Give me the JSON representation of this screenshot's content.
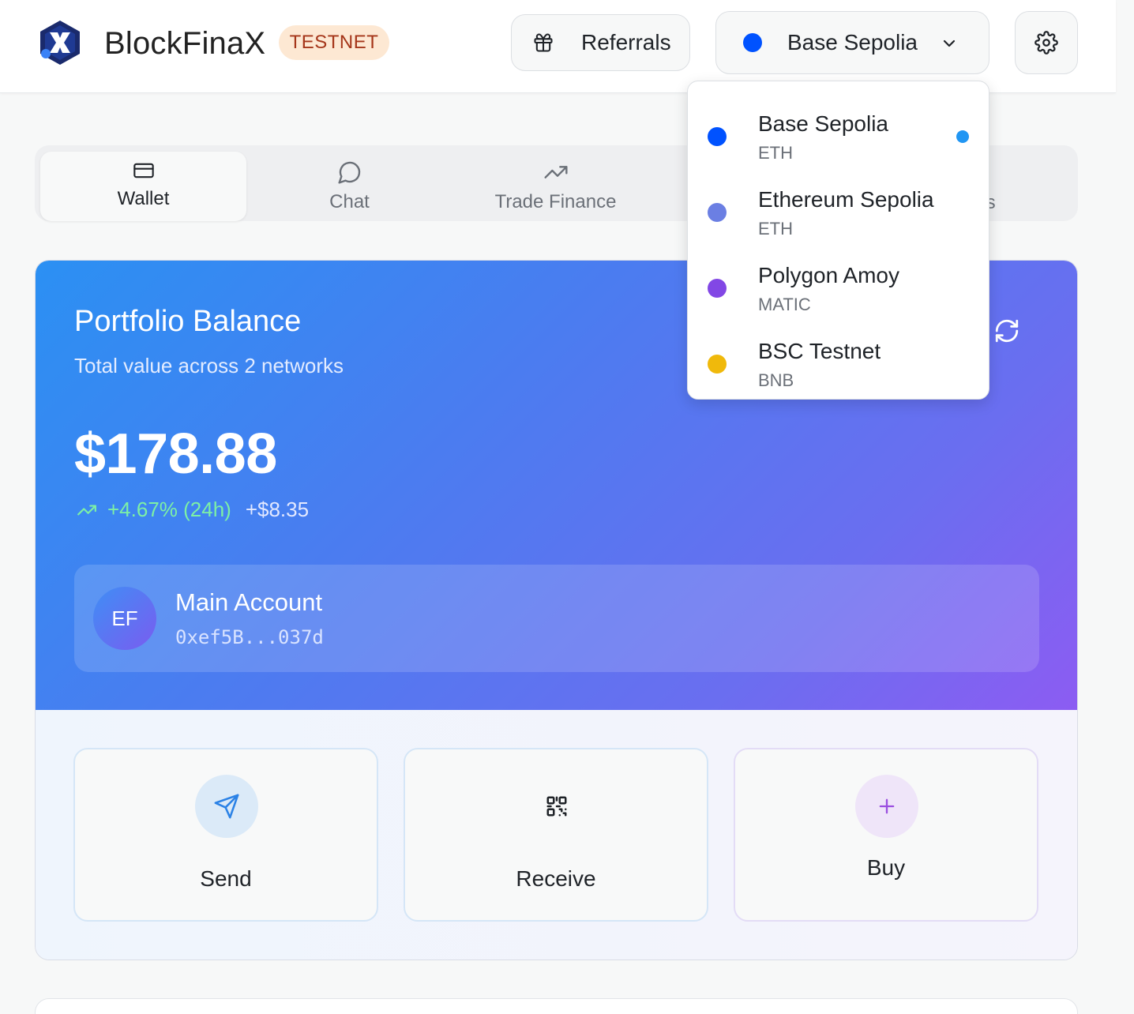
{
  "header": {
    "brand": "BlockFinaX",
    "badge": "TESTNET",
    "referrals_label": "Referrals",
    "network_label": "Base Sepolia",
    "network_color": "#0052ff"
  },
  "tabs": [
    {
      "label": "Wallet",
      "icon": "wallet-icon",
      "active": true
    },
    {
      "label": "Chat",
      "icon": "chat-icon",
      "active": false
    },
    {
      "label": "Trade Finance",
      "icon": "trending-up-icon",
      "active": false
    }
  ],
  "tab_partial": "cts",
  "portfolio": {
    "title": "Portfolio Balance",
    "subtitle": "Total value across 2 networks",
    "balance": "$178.88",
    "change_pct": "+4.67% (24h)",
    "change_amt": "+$8.35",
    "account": {
      "initials": "EF",
      "name": "Main Account",
      "address": "0xef5B...037d"
    }
  },
  "actions": [
    {
      "label": "Send",
      "icon": "send-icon"
    },
    {
      "label": "Receive",
      "icon": "qr-code-icon"
    },
    {
      "label": "Buy",
      "icon": "plus-icon"
    }
  ],
  "network_dropdown": {
    "items": [
      {
        "name": "Base Sepolia",
        "symbol": "ETH",
        "color": "#0052ff",
        "selected": true
      },
      {
        "name": "Ethereum Sepolia",
        "symbol": "ETH",
        "color": "#6b7fe3",
        "selected": false
      },
      {
        "name": "Polygon Amoy",
        "symbol": "MATIC",
        "color": "#8247e5",
        "selected": false
      },
      {
        "name": "BSC Testnet",
        "symbol": "BNB",
        "color": "#f0b90b",
        "selected": false
      }
    ]
  },
  "colors": {
    "accent_gradient_start": "#2b90f3",
    "accent_gradient_end": "#8c5cf2",
    "positive": "#7df0a5",
    "badge_bg": "#fde8d3",
    "badge_text": "#a5361a"
  }
}
